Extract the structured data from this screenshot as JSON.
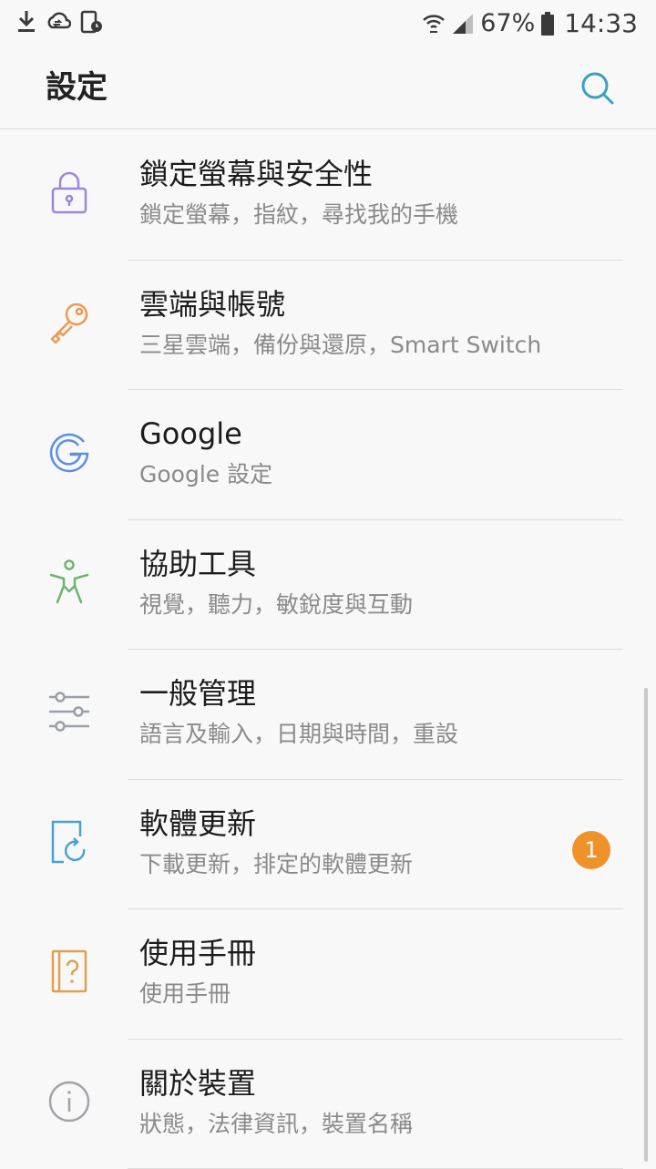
{
  "status_bar": {
    "battery": "67%",
    "time": "14:33"
  },
  "header": {
    "title": "設定"
  },
  "colors": {
    "lock": "#9b87d6",
    "key": "#ef9a55",
    "google": "#5b8fe6",
    "accessibility": "#6db56d",
    "general": "#9aa0a6",
    "update": "#4aa1d8",
    "manual": "#e0a050",
    "about": "#a0a4a8",
    "badge": "#f0922a"
  },
  "items": [
    {
      "icon": "lock-icon",
      "title": "鎖定螢幕與安全性",
      "subtitle": "鎖定螢幕，指紋，尋找我的手機"
    },
    {
      "icon": "key-icon",
      "title": "雲端與帳號",
      "subtitle": "三星雲端，備份與還原，Smart Switch"
    },
    {
      "icon": "google-icon",
      "title": "Google",
      "subtitle": "Google 設定"
    },
    {
      "icon": "accessibility-icon",
      "title": "協助工具",
      "subtitle": "視覺，聽力，敏銳度與互動"
    },
    {
      "icon": "sliders-icon",
      "title": "一般管理",
      "subtitle": "語言及輸入，日期與時間，重設"
    },
    {
      "icon": "software-update-icon",
      "title": "軟體更新",
      "subtitle": "下載更新，排定的軟體更新",
      "badge": "1"
    },
    {
      "icon": "user-manual-icon",
      "title": "使用手冊",
      "subtitle": "使用手冊"
    },
    {
      "icon": "info-icon",
      "title": "關於裝置",
      "subtitle": "狀態，法律資訊，裝置名稱"
    }
  ]
}
